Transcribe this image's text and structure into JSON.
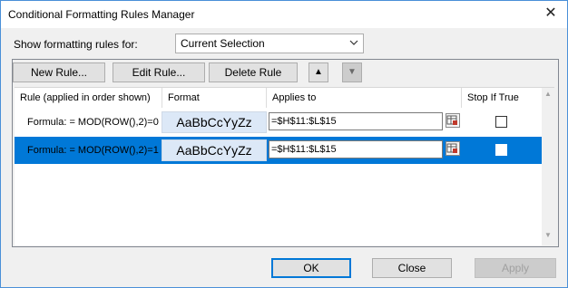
{
  "window": {
    "title": "Conditional Formatting Rules Manager",
    "close_glyph": "✕"
  },
  "show_rules": {
    "label": "Show formatting rules for:",
    "selected": "Current Selection"
  },
  "toolbar": {
    "new_rule": "New Rule...",
    "edit_rule": "Edit Rule...",
    "delete_rule": "Delete Rule",
    "move_up_glyph": "▲",
    "move_down_glyph": "▼"
  },
  "table": {
    "headers": [
      "Rule (applied in order shown)",
      "Format",
      "Applies to",
      "Stop If True"
    ],
    "rows": [
      {
        "rule": "Formula: = MOD(ROW(),2)=0",
        "format_preview": "AaBbCcYyZz",
        "applies_to": "=$H$11:$L$15",
        "stop_if_true": false,
        "selected": false
      },
      {
        "rule": "Formula: = MOD(ROW(),2)=1",
        "format_preview": "AaBbCcYyZz",
        "applies_to": "=$H$11:$L$15",
        "stop_if_true": false,
        "selected": true
      }
    ]
  },
  "footer": {
    "ok": "OK",
    "close": "Close",
    "apply": "Apply"
  },
  "colors": {
    "selection": "#0078d7",
    "format_preview_bg": "#dce8f7",
    "window_border": "#4a8fd8"
  }
}
